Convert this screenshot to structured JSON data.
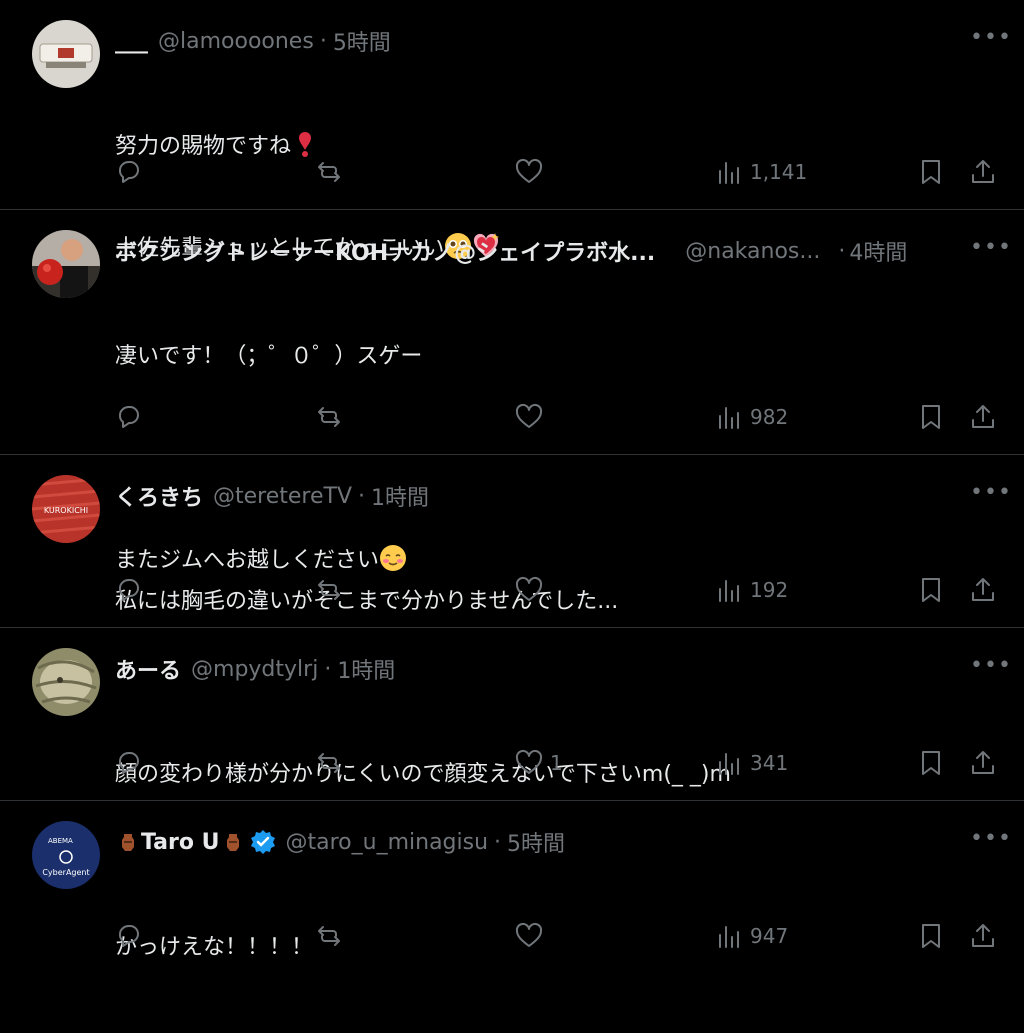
{
  "posts": [
    {
      "name": "___",
      "handle": "@lamoooones",
      "dot": "·",
      "time": "5時間",
      "lines": [
        "努力の賜物ですね",
        "土佐先輩シュッとしてかっこいい"
      ],
      "stats": {
        "reply": "",
        "repost": "",
        "like": "",
        "views": "1,141"
      }
    },
    {
      "name": "ボクシングトレーナーKOHナカノ@シェイプラボ水...",
      "handle": "@nakanos...",
      "dot": "·",
      "time": "4時間",
      "lines": [
        "凄いです！（；゜０゜）スゲー",
        "",
        "またジムへお越しください"
      ],
      "stats": {
        "reply": "",
        "repost": "",
        "like": "",
        "views": "982"
      }
    },
    {
      "name": "くろきち",
      "handle": "@teretereTV",
      "dot": "·",
      "time": "1時間",
      "avatar_text": "KUROKICHI",
      "lines": [
        "私には胸毛の違いがそこまで分かりませんでした..."
      ],
      "stats": {
        "reply": "",
        "repost": "",
        "like": "",
        "views": "192"
      }
    },
    {
      "name": "あーる",
      "handle": "@mpydtylrj",
      "dot": "·",
      "time": "1時間",
      "lines": [
        "顔の変わり様が分かりにくいので顔変えないで下さいm(_ _)m"
      ],
      "stats": {
        "reply": "",
        "repost": "",
        "like": "1",
        "views": "341"
      }
    },
    {
      "name": "Taro U",
      "handle": "@taro_u_minagisu",
      "dot": "·",
      "time": "5時間",
      "avatar_text": "CyberAgent",
      "avatar_small": "ABEMA",
      "lines": [
        "かっけえな！！！！"
      ],
      "stats": {
        "reply": "",
        "repost": "",
        "like": "",
        "views": "947"
      }
    }
  ],
  "colors": {
    "background": "#000000",
    "text": "#e7e9ea",
    "muted": "#71767b",
    "divider": "#2f3336",
    "verified": "#1d9bf0"
  },
  "icons": [
    "reply-icon",
    "repost-icon",
    "like-icon",
    "views-icon",
    "bookmark-icon",
    "share-icon",
    "more-icon",
    "verified-badge-icon"
  ]
}
